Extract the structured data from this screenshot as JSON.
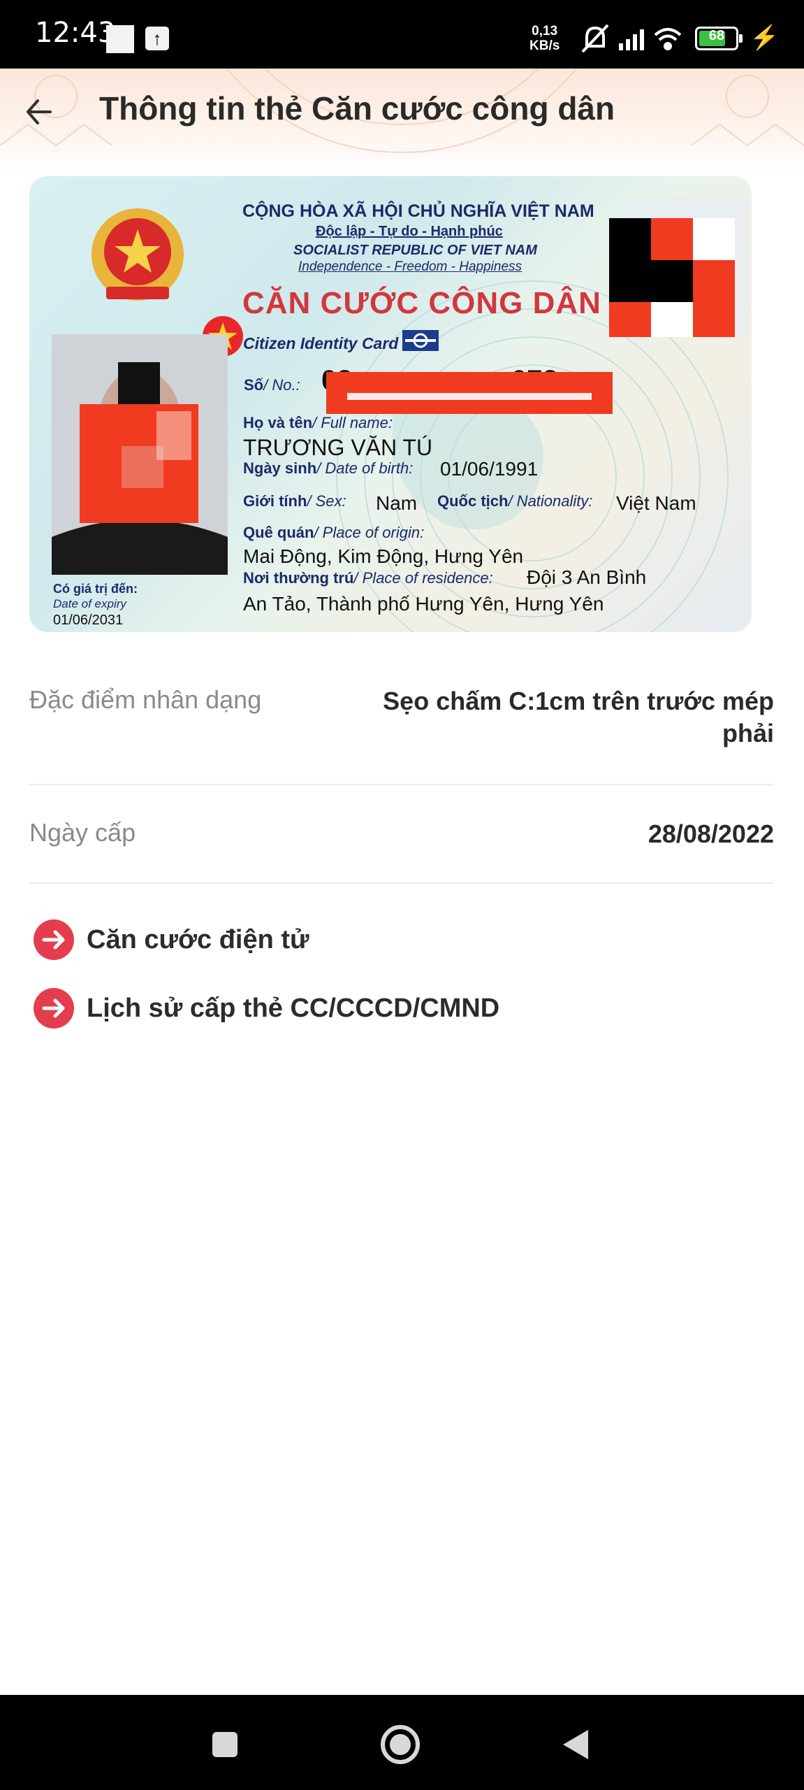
{
  "status_bar": {
    "time": "12:43",
    "net_speed_value": "0,13",
    "net_speed_unit": "KB/s",
    "battery": "68",
    "icons": [
      "image-notification-icon",
      "upload-icon",
      "mute-icon",
      "signal-icon",
      "wifi-icon",
      "battery-icon",
      "charging-icon"
    ]
  },
  "header": {
    "title": "Thông tin thẻ Căn cước công dân"
  },
  "id_card": {
    "republic_vi": "CỘNG HÒA XÃ HỘI CHỦ NGHĨA VIỆT NAM",
    "motto_vi": "Độc lập - Tự do - Hạnh phúc",
    "republic_en": "SOCIALIST REPUBLIC OF VIET NAM",
    "motto_en": "Independence - Freedom - Happiness",
    "card_title": "CĂN CƯỚC CÔNG DÂN",
    "card_subtitle": "Citizen Identity Card",
    "number_label": "Số",
    "number_label_en": "/ No.:",
    "number_visible_start": "02",
    "number_visible_end": "072",
    "name_label": "Họ và tên",
    "name_label_en": "/ Full name:",
    "name_value": "TRƯƠNG VĂN TÚ",
    "dob_label": "Ngày sinh",
    "dob_label_en": "/ Date of birth:",
    "dob_value": "01/06/1991",
    "sex_label": "Giới tính",
    "sex_label_en": "/ Sex:",
    "sex_value": "Nam",
    "nationality_label": "Quốc tịch",
    "nationality_label_en": "/ Nationality:",
    "nationality_value": "Việt Nam",
    "origin_label": "Quê quán",
    "origin_label_en": "/ Place of origin:",
    "origin_value": "Mai Động, Kim Động, Hưng Yên",
    "residence_label": "Nơi thường trú",
    "residence_label_en": "/ Place of residence:",
    "residence_value_1": "Đội 3  An Bình",
    "residence_value_2": "An Tảo, Thành phố Hưng Yên, Hưng Yên",
    "expiry_label": "Có giá trị đến:",
    "expiry_label_en": "Date of expiry",
    "expiry_value": "01/06/2031"
  },
  "details": [
    {
      "label": "Đặc điểm nhân dạng",
      "value_line1": "Sẹo chấm C:1cm trên trước mép",
      "value_line2": "phải"
    },
    {
      "label": "Ngày cấp",
      "value_line1": "28/08/2022"
    }
  ],
  "links": [
    {
      "label": "Căn cước điện tử"
    },
    {
      "label": "Lịch sử cấp thẻ CC/CCCD/CMND"
    }
  ],
  "colors": {
    "accent_red": "#e43d4e",
    "card_title_red": "#d2373e",
    "card_navy": "#1b2a6b",
    "redaction": "#f03b20"
  }
}
